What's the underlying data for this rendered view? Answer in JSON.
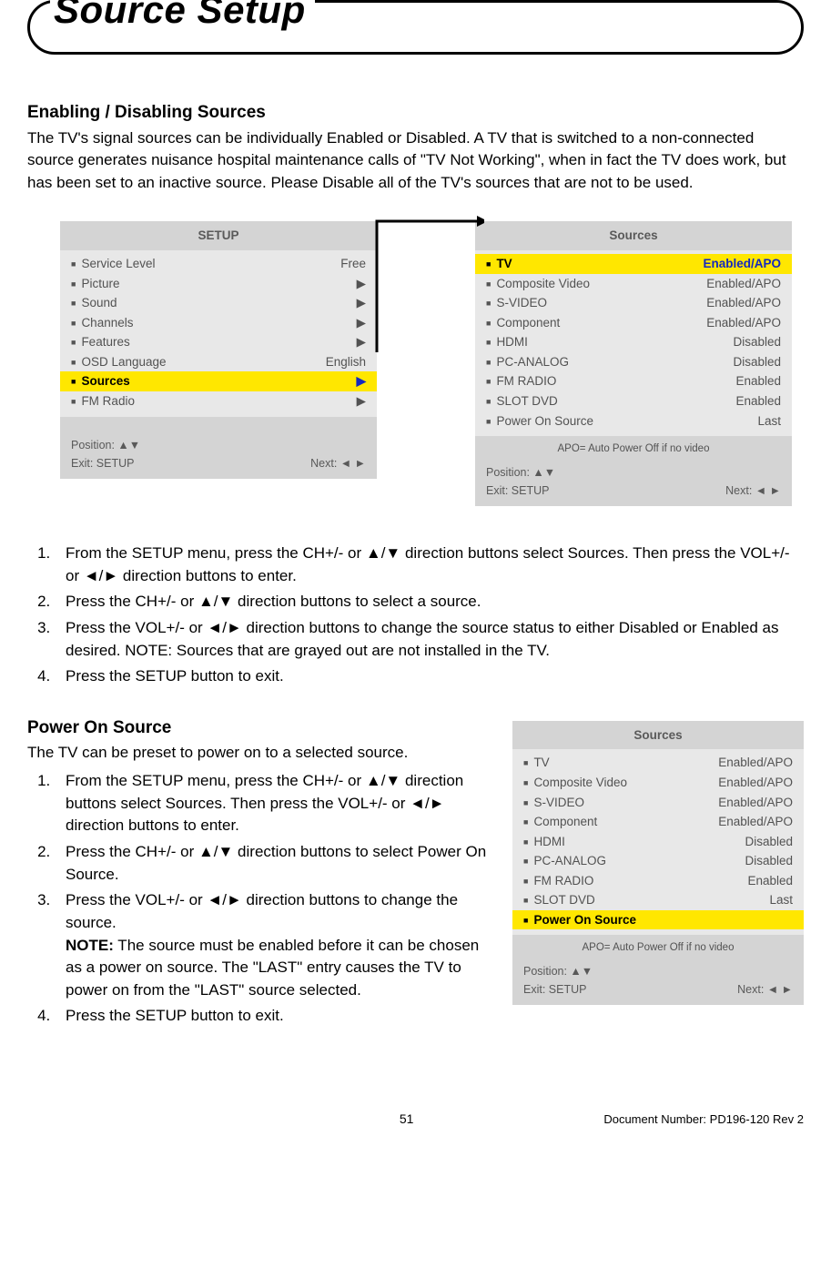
{
  "page_title": "Source Setup",
  "section1": {
    "heading": "Enabling / Disabling Sources",
    "intro": "The TV's signal sources can be individually Enabled or Disabled. A TV that is switched to a non-connected source generates nuisance hospital maintenance calls of \"TV Not Working\", when in fact the TV does work, but has been set to an inactive source. Please Disable all of the TV's sources that are not to be used.",
    "steps": [
      "From the SETUP menu, press the CH+/- or ▲/▼ direction buttons select Sources. Then press the VOL+/- or ◄/► direction buttons to enter.",
      "Press the CH+/- or ▲/▼ direction buttons to select a source.",
      "Press the VOL+/- or ◄/► direction buttons to change the source status to either Disabled or Enabled as desired. NOTE: Sources that are grayed out are not installed in the TV.",
      "Press the SETUP button to exit."
    ]
  },
  "section2": {
    "heading": "Power On Source",
    "intro": "The TV can be preset to power on to a selected source.",
    "steps": [
      "From the SETUP menu, press the CH+/- or ▲/▼ direction buttons select Sources. Then press the VOL+/- or ◄/► direction buttons to enter.",
      "Press the CH+/- or ▲/▼ direction buttons to select Power On Source.",
      "Press the VOL+/- or ◄/► direction buttons to change the source.",
      "Press the SETUP button to exit."
    ],
    "note_label": "NOTE:",
    "note_text": " The source must be enabled before it can be chosen as a power on source. The \"LAST\" entry causes the TV to power on from the \"LAST\" source selected."
  },
  "menu_setup": {
    "title": "SETUP",
    "rows": [
      {
        "label": "Service Level",
        "value": "Free"
      },
      {
        "label": "Picture",
        "value": "▶"
      },
      {
        "label": "Sound",
        "value": "▶"
      },
      {
        "label": "Channels",
        "value": "▶"
      },
      {
        "label": "Features",
        "value": "▶"
      },
      {
        "label": "OSD Language",
        "value": "English"
      },
      {
        "label": "Sources",
        "value": "▶",
        "selected": true
      },
      {
        "label": "FM Radio",
        "value": "▶"
      }
    ],
    "footer_left1": "Position: ▲▼",
    "footer_left2": "Exit: SETUP",
    "footer_right": "Next: ◄ ►"
  },
  "menu_sources_a": {
    "title": "Sources",
    "rows": [
      {
        "label": "TV",
        "value": "Enabled/APO",
        "selected": true
      },
      {
        "label": "Composite Video",
        "value": "Enabled/APO"
      },
      {
        "label": "S-VIDEO",
        "value": "Enabled/APO"
      },
      {
        "label": "Component",
        "value": "Enabled/APO"
      },
      {
        "label": "HDMI",
        "value": "Disabled"
      },
      {
        "label": "PC-ANALOG",
        "value": "Disabled"
      },
      {
        "label": "FM RADIO",
        "value": "Enabled"
      },
      {
        "label": "SLOT DVD",
        "value": "Enabled"
      },
      {
        "label": "Power On Source",
        "value": "Last"
      }
    ],
    "note": "APO= Auto Power Off if no video",
    "footer_left1": "Position: ▲▼",
    "footer_left2": "Exit: SETUP",
    "footer_right": "Next: ◄ ►"
  },
  "menu_sources_b": {
    "title": "Sources",
    "rows": [
      {
        "label": "TV",
        "value": "Enabled/APO"
      },
      {
        "label": "Composite Video",
        "value": "Enabled/APO"
      },
      {
        "label": "S-VIDEO",
        "value": "Enabled/APO"
      },
      {
        "label": "Component",
        "value": "Enabled/APO"
      },
      {
        "label": "HDMI",
        "value": "Disabled"
      },
      {
        "label": "PC-ANALOG",
        "value": "Disabled"
      },
      {
        "label": "FM RADIO",
        "value": "Enabled"
      },
      {
        "label": "SLOT DVD",
        "value": "Last"
      },
      {
        "label": "Power On Source",
        "value": "",
        "selected": true
      }
    ],
    "note": "APO= Auto Power Off if no video",
    "footer_left1": "Position: ▲▼",
    "footer_left2": "Exit: SETUP",
    "footer_right": "Next: ◄ ►"
  },
  "page_number": "51",
  "doc_number": "Document Number: PD196-120 Rev 2"
}
